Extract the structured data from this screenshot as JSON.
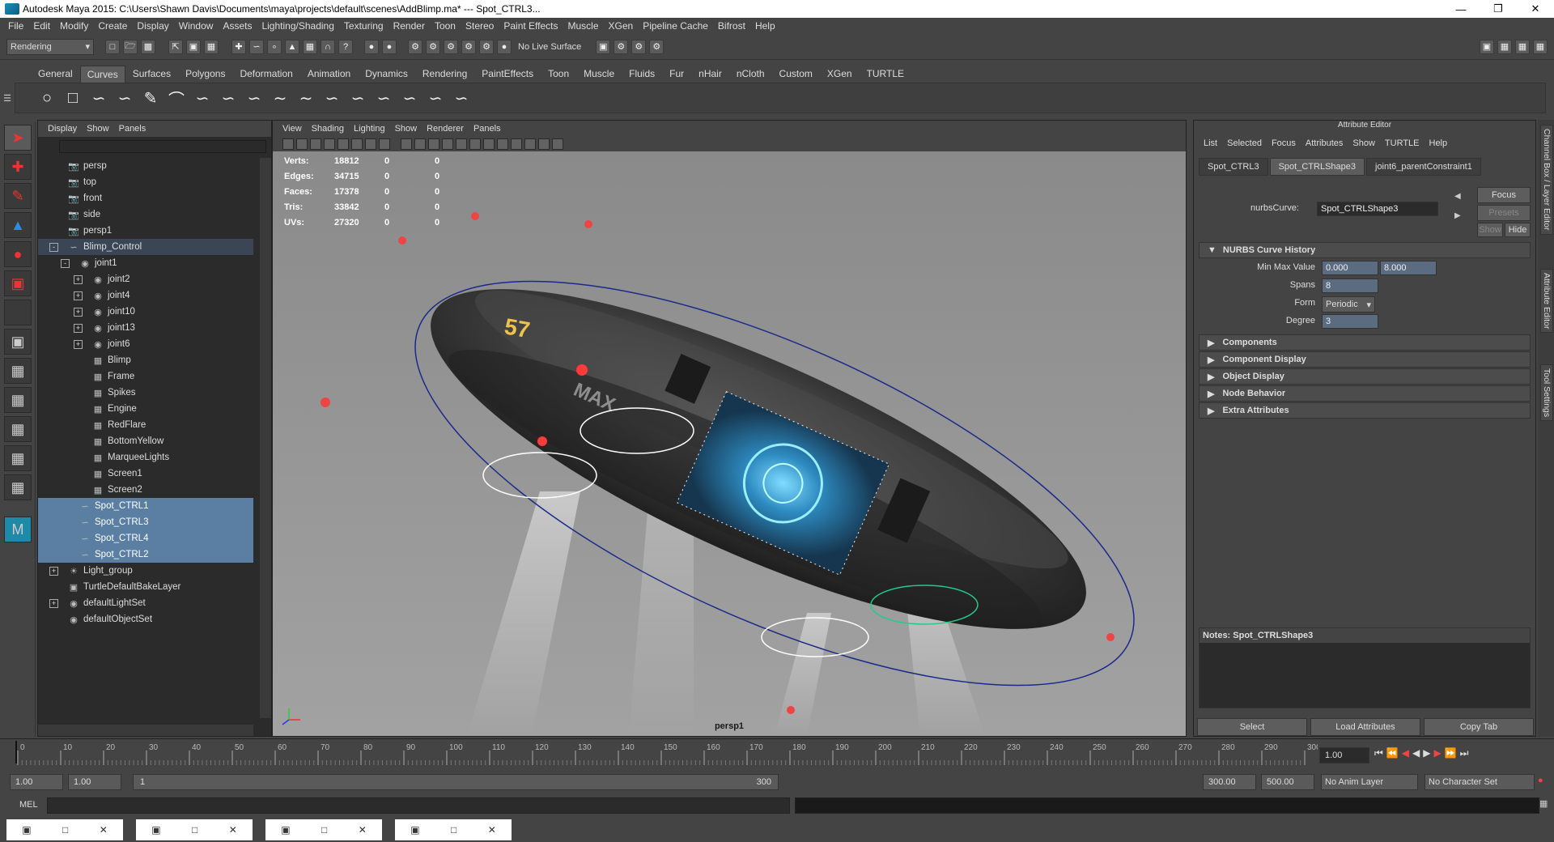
{
  "window": {
    "title": "Autodesk Maya 2015: C:\\Users\\Shawn Davis\\Documents\\maya\\projects\\default\\scenes\\AddBlimp.ma*   ---   Spot_CTRL3..."
  },
  "menus": [
    "File",
    "Edit",
    "Modify",
    "Create",
    "Display",
    "Window",
    "Assets",
    "Lighting/Shading",
    "Texturing",
    "Render",
    "Toon",
    "Stereo",
    "Paint Effects",
    "Muscle",
    "XGen",
    "Pipeline Cache",
    "Bifrost",
    "Help"
  ],
  "statusline": {
    "menuset": "Rendering",
    "live_surface": "No Live Surface"
  },
  "shelf_tabs": [
    "General",
    "Curves",
    "Surfaces",
    "Polygons",
    "Deformation",
    "Animation",
    "Dynamics",
    "Rendering",
    "PaintEffects",
    "Toon",
    "Muscle",
    "Fluids",
    "Fur",
    "nHair",
    "nCloth",
    "Custom",
    "XGen",
    "TURTLE"
  ],
  "shelf_active": "Curves",
  "outliner": {
    "menu": [
      "Display",
      "Show",
      "Panels"
    ],
    "rows": [
      {
        "label": "persp",
        "icon": "camera-icon",
        "indent": 1
      },
      {
        "label": "top",
        "icon": "camera-icon",
        "indent": 1
      },
      {
        "label": "front",
        "icon": "camera-icon",
        "indent": 1
      },
      {
        "label": "side",
        "icon": "camera-icon",
        "indent": 1
      },
      {
        "label": "persp1",
        "icon": "camera-icon",
        "indent": 1
      },
      {
        "label": "Blimp_Control",
        "icon": "curve-icon",
        "indent": 1,
        "state": "highlight",
        "expand": "-"
      },
      {
        "label": "joint1",
        "icon": "joint-icon",
        "indent": 2,
        "expand": "-"
      },
      {
        "label": "joint2",
        "icon": "joint-icon",
        "indent": 3,
        "expand": "+"
      },
      {
        "label": "joint4",
        "icon": "joint-icon",
        "indent": 3,
        "expand": "+"
      },
      {
        "label": "joint10",
        "icon": "joint-icon",
        "indent": 3,
        "expand": "+"
      },
      {
        "label": "joint13",
        "icon": "joint-icon",
        "indent": 3,
        "expand": "+"
      },
      {
        "label": "joint6",
        "icon": "joint-icon",
        "indent": 3,
        "expand": "+"
      },
      {
        "label": "Blimp",
        "icon": "mesh-icon",
        "indent": 3
      },
      {
        "label": "Frame",
        "icon": "mesh-icon",
        "indent": 3
      },
      {
        "label": "Spikes",
        "icon": "mesh-icon",
        "indent": 3
      },
      {
        "label": "Engine",
        "icon": "mesh-icon",
        "indent": 3
      },
      {
        "label": "RedFlare",
        "icon": "mesh-icon",
        "indent": 3
      },
      {
        "label": "BottomYellow",
        "icon": "mesh-icon",
        "indent": 3
      },
      {
        "label": "MarqueeLights",
        "icon": "mesh-icon",
        "indent": 3
      },
      {
        "label": "Screen1",
        "icon": "mesh-icon",
        "indent": 3
      },
      {
        "label": "Screen2",
        "icon": "mesh-icon",
        "indent": 3
      },
      {
        "label": "Spot_CTRL1",
        "icon": "curve-icon",
        "indent": 2,
        "state": "selected"
      },
      {
        "label": "Spot_CTRL3",
        "icon": "curve-icon",
        "indent": 2,
        "state": "selected"
      },
      {
        "label": "Spot_CTRL4",
        "icon": "curve-icon",
        "indent": 2,
        "state": "selected"
      },
      {
        "label": "Spot_CTRL2",
        "icon": "curve-icon",
        "indent": 2,
        "state": "selected"
      },
      {
        "label": "Light_group",
        "icon": "light-icon",
        "indent": 1,
        "expand": "+"
      },
      {
        "label": "TurtleDefaultBakeLayer",
        "icon": "layer-icon",
        "indent": 1
      },
      {
        "label": "defaultLightSet",
        "icon": "set-icon",
        "indent": 1,
        "expand": "+"
      },
      {
        "label": "defaultObjectSet",
        "icon": "set-icon",
        "indent": 1
      }
    ]
  },
  "viewport": {
    "menu": [
      "View",
      "Shading",
      "Lighting",
      "Show",
      "Renderer",
      "Panels"
    ],
    "camera": "persp1",
    "hud": [
      {
        "label": "Verts:",
        "v1": "18812",
        "v2": "0",
        "v3": "0"
      },
      {
        "label": "Edges:",
        "v1": "34715",
        "v2": "0",
        "v3": "0"
      },
      {
        "label": "Faces:",
        "v1": "17378",
        "v2": "0",
        "v3": "0"
      },
      {
        "label": "Tris:",
        "v1": "33842",
        "v2": "0",
        "v3": "0"
      },
      {
        "label": "UVs:",
        "v1": "27320",
        "v2": "0",
        "v3": "0"
      }
    ],
    "blimp_numbers": "57",
    "blimp_text": "MAX"
  },
  "attr": {
    "title": "Attribute Editor",
    "menu": [
      "List",
      "Selected",
      "Focus",
      "Attributes",
      "Show",
      "TURTLE",
      "Help"
    ],
    "tabs": [
      "Spot_CTRL3",
      "Spot_CTRLShape3",
      "joint6_parentConstraint1"
    ],
    "active_tab": "Spot_CTRLShape3",
    "node_label": "nurbsCurve:",
    "node_value": "Spot_CTRLShape3",
    "focus": "Focus",
    "presets": "Presets",
    "show": "Show",
    "hide": "Hide",
    "history_title": "NURBS Curve History",
    "min_max_label": "Min Max Value",
    "min": "0.000",
    "max": "8.000",
    "spans_label": "Spans",
    "spans": "8",
    "form_label": "Form",
    "form": "Periodic",
    "degree_label": "Degree",
    "degree": "3",
    "sections": [
      "Components",
      "Component Display",
      "Object Display",
      "Node Behavior",
      "Extra Attributes"
    ],
    "notes": "Notes:  Spot_CTRLShape3",
    "buttons": [
      "Select",
      "Load Attributes",
      "Copy Tab"
    ]
  },
  "side_tabs": [
    "Channel Box / Layer Editor",
    "Attribute Editor",
    "Tool Settings"
  ],
  "time": {
    "ticks": [
      "0",
      "10",
      "20",
      "30",
      "40",
      "50",
      "60",
      "70",
      "80",
      "90",
      "100",
      "110",
      "120",
      "130",
      "140",
      "150",
      "160",
      "170",
      "180",
      "190",
      "200",
      "210",
      "220",
      "230",
      "240",
      "250",
      "260",
      "270",
      "280",
      "290",
      "300"
    ],
    "current": "1.00",
    "range_start": "1.00",
    "range_start2": "1.00",
    "slider_start": "1",
    "slider_end": "300",
    "end1": "300.00",
    "end2": "500.00",
    "anim_layer": "No Anim Layer",
    "char_set": "No Character Set"
  },
  "cmd": {
    "label": "MEL"
  }
}
